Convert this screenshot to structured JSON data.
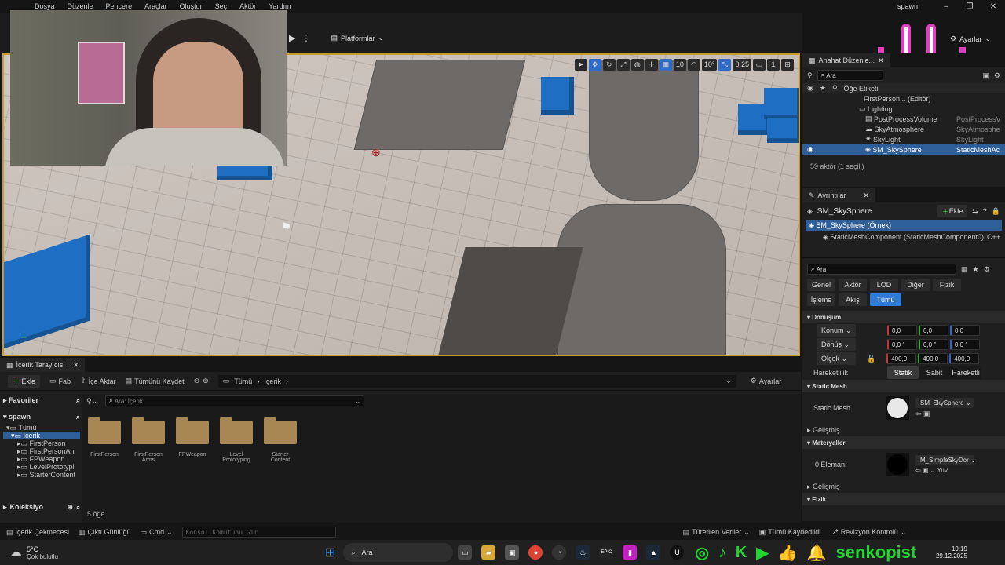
{
  "menu": [
    "Dosya",
    "Düzenle",
    "Pencere",
    "Araçlar",
    "Oluştur",
    "Seç",
    "Aktör",
    "Yardım"
  ],
  "project_name": "spawn",
  "toolbar": {
    "platforms": "Platformlar",
    "settings": "Ayarlar"
  },
  "viewport": {
    "grid_size": "10",
    "rot_snap": "10°",
    "scale_snap": "0,25",
    "cam_speed": "1"
  },
  "outliner": {
    "tab": "Anahat Düzenle...",
    "search_placeholder": "Ara",
    "col_label": "Öğe Etiketi",
    "items": [
      {
        "label": "FirstPerson... (Editör)",
        "type": "",
        "indent": 1
      },
      {
        "label": "Lighting",
        "type": "",
        "indent": 2
      },
      {
        "label": "PostProcessVolume",
        "type": "PostProcessV",
        "indent": 3
      },
      {
        "label": "SkyAtmosphere",
        "type": "SkyAtmosphe",
        "indent": 3
      },
      {
        "label": "SkyLight",
        "type": "SkyLight",
        "indent": 3
      },
      {
        "label": "SM_SkySphere",
        "type": "StaticMeshAc",
        "indent": 3
      }
    ],
    "status": "59 aktör (1 seçili)"
  },
  "details": {
    "tab": "Ayrıntılar",
    "object": "SM_SkySphere",
    "add": "Ekle",
    "instance": "SM_SkySphere (Örnek)",
    "component": "StaticMeshComponent (StaticMeshComponent0)",
    "component_lang": "C++",
    "search_placeholder": "Ara",
    "filters_row1": [
      "Genel",
      "Aktör",
      "LOD",
      "Diğer",
      "Fizik"
    ],
    "filters_row2": [
      "İşleme",
      "Akış",
      "Tümü"
    ],
    "transform_title": "Dönüşüm",
    "location_label": "Konum",
    "location": [
      "0,0",
      "0,0",
      "0,0"
    ],
    "rotation_label": "Dönüş",
    "rotation": [
      "0,0 °",
      "0,0 °",
      "0,0 °"
    ],
    "scale_label": "Ölçek",
    "scale": [
      "400,0",
      "400,0",
      "400,0"
    ],
    "mobility_label": "Hareketlilik",
    "mobility": [
      "Statik",
      "Sabit",
      "Hareketli"
    ],
    "static_mesh_title": "Static Mesh",
    "static_mesh_label": "Static Mesh",
    "static_mesh_value": "SM_SkySphere",
    "advanced": "Gelişmiş",
    "materials_title": "Materyaller",
    "elements_label": "0 Elemanı",
    "material_value": "M_SimpleSkyDor",
    "material_extra": "Yuv",
    "physics_title": "Fizik"
  },
  "content": {
    "tab": "İçerik Tarayıcısı",
    "add": "Ekle",
    "fab": "Fab",
    "import": "İçe Aktar",
    "save_all": "Tümünü Kaydet",
    "path": [
      "Tümü",
      "İçerik"
    ],
    "settings": "Ayarlar",
    "favorites": "Favoriler",
    "project": "spawn",
    "tree": [
      {
        "label": "Tümü",
        "indent": 0,
        "selected": false
      },
      {
        "label": "İçerik",
        "indent": 1,
        "selected": true
      },
      {
        "label": "FirstPerson",
        "indent": 2,
        "selected": false
      },
      {
        "label": "FirstPersonArr",
        "indent": 2,
        "selected": false
      },
      {
        "label": "FPWeapon",
        "indent": 2,
        "selected": false
      },
      {
        "label": "LevelPrototypi",
        "indent": 2,
        "selected": false
      },
      {
        "label": "StarterContent",
        "indent": 2,
        "selected": false
      }
    ],
    "collections": "Koleksiyo",
    "search_placeholder": "Ara: İçerik",
    "folders": [
      "FirstPerson",
      "FirstPerson\nArms",
      "FPWeapon",
      "Level\nPrototyping",
      "Starter\nContent"
    ],
    "count": "5 öğe"
  },
  "statusbar": {
    "drawer": "İçerik Çekmecesi",
    "log": "Çıktı Günlüğü",
    "cmd": "Cmd",
    "console_placeholder": "Konsol Komutunu Gir",
    "derived": "Türetilen Veriler",
    "saved": "Tümü Kaydedildi",
    "revision": "Revizyon Kontrolü"
  },
  "taskbar": {
    "weather_temp": "5°C",
    "weather_desc": "Çok bulutlu",
    "search": "Ara",
    "time": "19:19",
    "date": "29.12.2025"
  },
  "overlay": {
    "handle": "senkopist"
  }
}
